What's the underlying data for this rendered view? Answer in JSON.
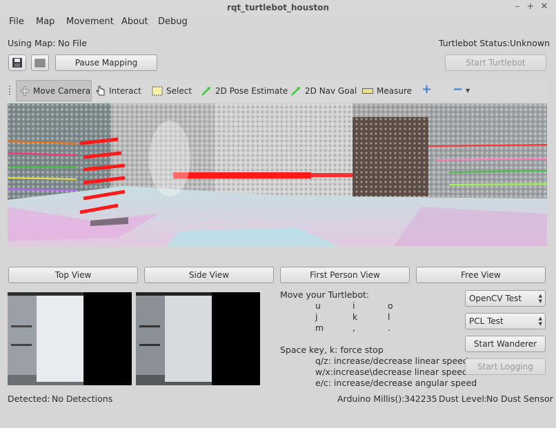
{
  "window": {
    "title": "rqt_turtlebot_houston"
  },
  "menu": [
    "File",
    "Map",
    "Movement",
    "About",
    "Debug"
  ],
  "map": {
    "label": "Using Map:",
    "value": "No File"
  },
  "status": {
    "label": "Turtlebot Status:",
    "value": "Unknown"
  },
  "buttons": {
    "pause_mapping": "Pause Mapping",
    "start_turtlebot": "Start Turtlebot",
    "start_wanderer": "Start Wanderer",
    "start_logging": "Start Logging"
  },
  "tools": {
    "move_camera": "Move Camera",
    "interact": "Interact",
    "select": "Select",
    "pose_estimate": "2D Pose Estimate",
    "nav_goal": "2D Nav Goal",
    "measure": "Measure"
  },
  "views": [
    "Top View",
    "Side View",
    "First Person View",
    "Free View"
  ],
  "controls": {
    "heading": "Move your Turtlebot:",
    "keys": [
      [
        "u",
        "i",
        "o"
      ],
      [
        "j",
        "k",
        "l"
      ],
      [
        "m",
        ",",
        "."
      ]
    ],
    "stop": "Space key, k: force stop",
    "linear": "q/z: increase/decrease linear speed",
    "linear2": "w/x:increase\\decrease linear speed",
    "angular": "e/c: increase/decrease angular speed"
  },
  "combos": {
    "opencv": "OpenCV Test",
    "pcl": "PCL Test"
  },
  "footer": {
    "detected_label": "Detected:",
    "detected_value": "No Detections",
    "arduino_label": "Arduino Millis():",
    "arduino_value": "342235",
    "dust_label": "Dust Level:",
    "dust_value": "No Dust Sensor"
  }
}
